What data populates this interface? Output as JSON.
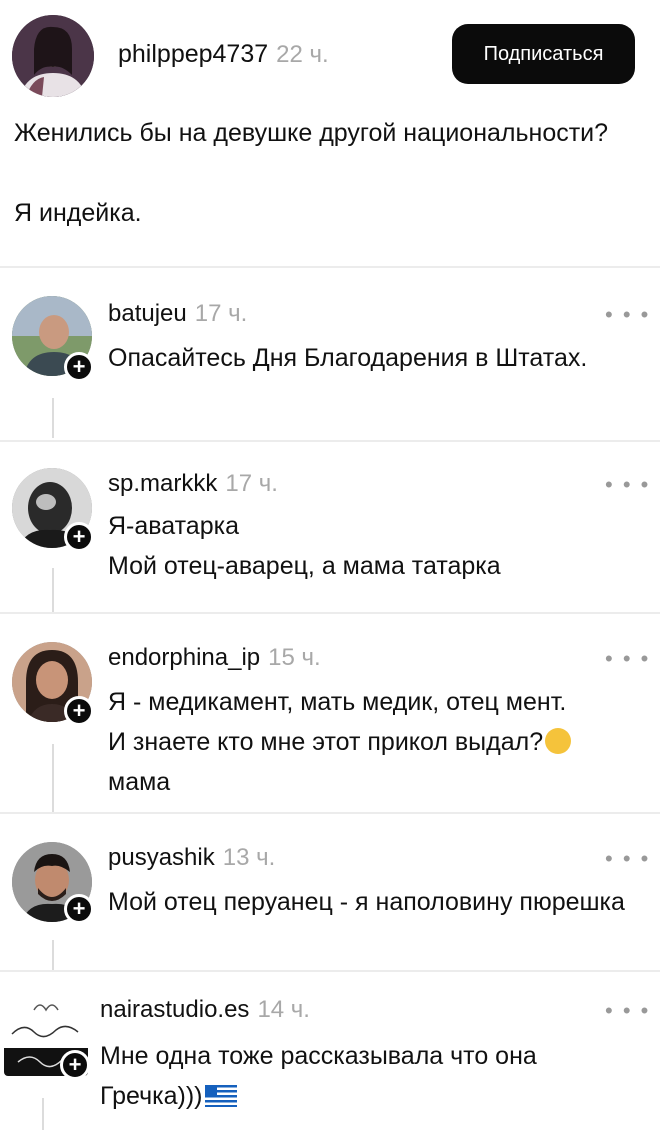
{
  "post": {
    "username": "philppep4737",
    "time": "22 ч.",
    "follow_label": "Подписаться",
    "question": "Женились бы на девушке другой национальности?",
    "text": "Я индейка."
  },
  "comments": [
    {
      "username": "batujeu",
      "time": "17 ч.",
      "lines": [
        "Опасайтесь Дня Благодарения в Штатах."
      ]
    },
    {
      "username": "sp.markkk",
      "time": "17 ч.",
      "lines": [
        "Я-аватарка",
        "Мой отец-аварец, а мама татарка"
      ]
    },
    {
      "username": "endorphina_ip",
      "time": "15 ч.",
      "lines": [
        "Я - медикамент, мать медик, отец мент.",
        "И знаете кто мне этот прикол выдал?",
        "мама"
      ]
    },
    {
      "username": "pusyashik",
      "time": "13 ч.",
      "lines": [
        "Мой отец перуанец - я наполовину пюрешка"
      ]
    },
    {
      "username": "nairastudio.es",
      "time": "14 ч.",
      "lines": [
        "Мне одна тоже рассказывала что она Гречка)))"
      ]
    }
  ],
  "icons": {
    "more": "more-dots-icon",
    "follow": "plus-icon",
    "emoji": "laughing-emoji-icon",
    "flag": "greece-flag-icon"
  },
  "more_glyph": "• • •",
  "plus_glyph": "+"
}
